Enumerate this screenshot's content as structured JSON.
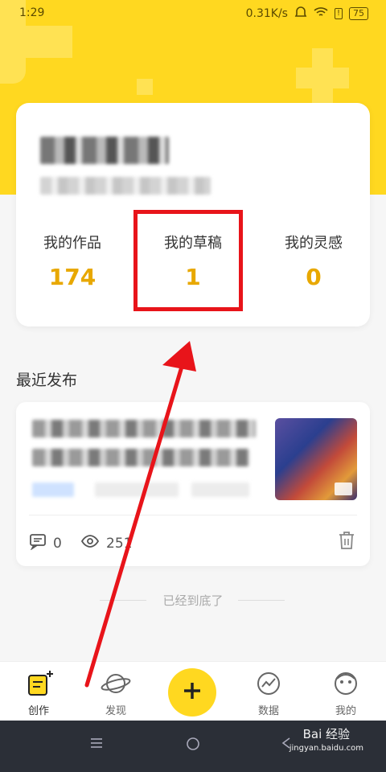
{
  "status_bar": {
    "time": "1:29",
    "network_speed": "0.31K/s",
    "battery": "75"
  },
  "profile": {
    "stats": [
      {
        "label": "我的作品",
        "value": "174"
      },
      {
        "label": "我的草稿",
        "value": "1"
      },
      {
        "label": "我的灵感",
        "value": "0"
      }
    ]
  },
  "recent": {
    "title": "最近发布",
    "post": {
      "comment_count": "0",
      "view_count": "251"
    }
  },
  "end_text": "已经到底了",
  "tabbar": {
    "tabs": [
      {
        "label": "创作",
        "icon": "create-icon"
      },
      {
        "label": "发现",
        "icon": "planet-icon"
      },
      {
        "label": "",
        "icon": "plus-icon"
      },
      {
        "label": "数据",
        "icon": "chart-icon"
      },
      {
        "label": "我的",
        "icon": "profile-icon"
      }
    ]
  },
  "watermark": {
    "brand": "Bai 经验",
    "url": "jingyan.baidu.com"
  },
  "colors": {
    "brand_yellow": "#ffd820",
    "stat_value": "#e8a800",
    "annotation_red": "#e8141a"
  }
}
